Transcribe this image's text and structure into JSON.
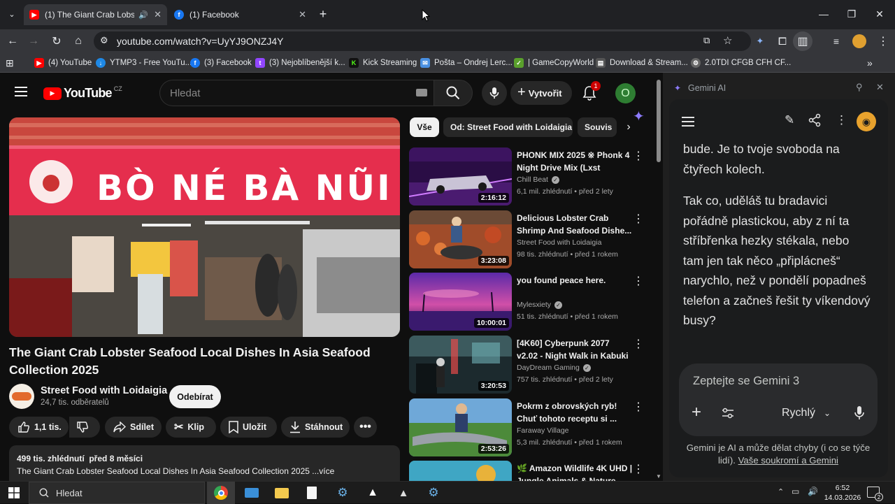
{
  "browser": {
    "tabs": [
      {
        "title": "(1) The Giant Crab Lobster S",
        "favicon": "youtube-icon",
        "active": true,
        "audio": true
      },
      {
        "title": "(1) Facebook",
        "favicon": "facebook-icon",
        "active": false
      }
    ],
    "url": "youtube.com/watch?v=UyYJ9ONZJ4Y",
    "bookmarks": [
      {
        "label": "(4) YouTube",
        "icon": "youtube-icon",
        "color": "#ff0000"
      },
      {
        "label": "YTMP3 - Free YouTu...",
        "icon": "ytmp3-icon",
        "color": "#1e88e5"
      },
      {
        "label": "(3) Facebook",
        "icon": "facebook-icon",
        "color": "#1877f2"
      },
      {
        "label": "(3) Nejoblíbenější k...",
        "icon": "twitch-icon",
        "color": "#9146ff"
      },
      {
        "label": "Kick Streaming",
        "icon": "kick-icon",
        "color": "#53fc18"
      },
      {
        "label": "Pošta – Ondrej Lerc...",
        "icon": "mail-icon",
        "color": "#4a90e2"
      },
      {
        "label": "| GameCopyWorld",
        "icon": "gamecopyworld-icon",
        "color": "#5aa02c"
      },
      {
        "label": "Download & Stream...",
        "icon": "download-icon",
        "color": "#777777"
      },
      {
        "label": "2.0TDI CFGB CFH CF...",
        "icon": "gear-icon",
        "color": "#888888"
      }
    ]
  },
  "youtube": {
    "logo_text": "YouTube",
    "region": "CZ",
    "search_placeholder": "Hledat",
    "create_label": "Vytvořit",
    "notification_count": "1",
    "avatar_letter": "O",
    "video": {
      "title": "The Giant Crab Lobster Seafood Local Dishes In Asia Seafood Collection 2025",
      "sign_text": "BÒ NÉ BÀ NŨI",
      "channel": "Street Food with Loidaigia",
      "subscribers": "24,7 tis. odběratelů",
      "subscribe_label": "Odebírat",
      "likes": "1,1 tis.",
      "share_label": "Sdílet",
      "clip_label": "Klip",
      "save_label": "Uložit",
      "download_label": "Stáhnout",
      "views_date": "499 tis. zhlédnutí  před 8 měsíci",
      "description": "The Giant Crab Lobster Seafood Local Dishes In Asia Seafood Collection 2025 ...více"
    },
    "chips": [
      "Vše",
      "Od: Street Food with Loidaigia",
      "Souvis"
    ],
    "recommendations": [
      {
        "title": "PHONK MIX 2025 ※ Phonk 4 Night Drive Mix (Lxst Cxntu...",
        "channel": "Chill Beat",
        "verified": true,
        "meta": "6,1 mil. zhlédnutí • před 2 lety",
        "duration": "2:16:12",
        "theme": "purple-car"
      },
      {
        "title": "Delicious Lobster Crab Shrimp And Seafood Dishe...",
        "channel": "Street Food with Loidaigia",
        "verified": false,
        "meta": "98 tis. zhlédnutí • před 1 rokem",
        "duration": "3:23:08",
        "theme": "seafood"
      },
      {
        "title": "you found peace here.",
        "channel": "Mylesxiety",
        "verified": true,
        "meta": "51 tis. zhlédnutí • před 1 rokem",
        "duration": "10:00:01",
        "theme": "sunset"
      },
      {
        "title": "[4K60] Cyberpunk 2077 v2.02 - Night Walk in Kabuki (Path...",
        "channel": "DayDream Gaming",
        "verified": true,
        "meta": "757 tis. zhlédnutí • před 2 lety",
        "duration": "3:20:53",
        "theme": "cyber"
      },
      {
        "title": "Pokrm z obrovských ryb! Chuť tohoto receptu si ...",
        "channel": "Faraway Village",
        "verified": false,
        "meta": "5,3 mil. zhlédnutí • před 1 rokem",
        "duration": "2:53:26",
        "theme": "fish"
      },
      {
        "title": "🌿 Amazon Wildlife 4K UHD | Jungle Animals & Nature...",
        "channel": "",
        "verified": false,
        "meta": "",
        "duration": "",
        "theme": "jungle"
      }
    ]
  },
  "gemini": {
    "title": "Gemini AI",
    "response": "bude. Je to tvoje svoboda na čtyřech kolech.\n\nTak co, uděláš tu bradavici pořádně plastickou, aby z ní ta stříbřenka hezky stékala, nebo tam jen tak něco „připlácneš“ narychlo, než v pondělí popadneš telefon a začneš řešit ty víkendový busy?",
    "response_p1": "bude. Je to tvoje svoboda na čtyřech kolech.",
    "response_p2": "Tak co, uděláš tu bradavici pořádně plastickou, aby z ní ta stříbřenka hezky stékala, nebo tam jen tak něco „připlácneš“ narychlo, než v pondělí popadneš telefon a začneš řešit ty víkendový busy?",
    "input_placeholder": "Zeptejte se Gemini 3",
    "mode_label": "Rychlý",
    "footer": "Gemini je AI a může dělat chyby (i co se týče lidí).",
    "privacy_link": "Vaše soukromí a Gemini"
  },
  "taskbar": {
    "search_placeholder": "Hledat",
    "time": "6:52",
    "date": "14.03.2026",
    "notifications": "2"
  },
  "colors": {
    "youtube_red": "#ff0000",
    "subscribe_bg": "#f1f1f1",
    "avatar_green": "#2e7d32"
  }
}
